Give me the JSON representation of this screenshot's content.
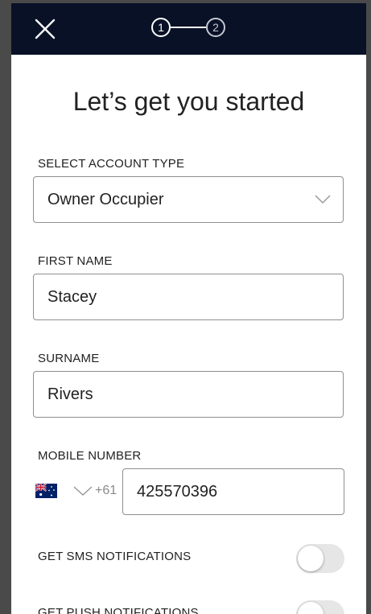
{
  "header": {
    "steps": [
      "1",
      "2"
    ],
    "active_step": 1
  },
  "form": {
    "title": "Let’s get you started",
    "account_type": {
      "label": "SELECT ACCOUNT TYPE",
      "value": "Owner Occupier"
    },
    "first_name": {
      "label": "FIRST NAME",
      "value": "Stacey"
    },
    "surname": {
      "label": "SURNAME",
      "value": "Rivers"
    },
    "mobile": {
      "label": "MOBILE NUMBER",
      "country_flag": "australia-flag-icon",
      "prefix": "+61",
      "value": "425570396"
    },
    "sms": {
      "label": "GET SMS NOTIFICATIONS",
      "enabled": false
    },
    "push": {
      "label": "GET PUSH NOTIFICATIONS",
      "enabled": false
    }
  },
  "colors": {
    "header_bg": "#081126",
    "text": "#222222",
    "border": "#8f8f8f",
    "toggle_off": "#e6e6e6"
  }
}
